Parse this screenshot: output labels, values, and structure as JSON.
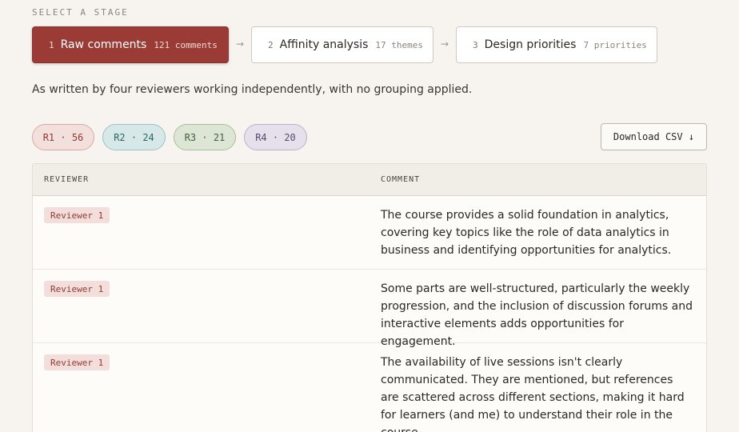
{
  "section_label": "SELECT A STAGE",
  "stages": [
    {
      "num": "1",
      "name": "Raw comments",
      "count": "121 comments",
      "active": true
    },
    {
      "num": "2",
      "name": "Affinity analysis",
      "count": "17 themes",
      "active": false
    },
    {
      "num": "3",
      "name": "Design priorities",
      "count": "7 priorities",
      "active": false
    }
  ],
  "stage_separator": "→",
  "description": "As written by four reviewers working independently, with no grouping applied.",
  "reviewer_filters": [
    {
      "label": "R1 · 56",
      "color": "#8f3a34"
    },
    {
      "label": "R2 · 24",
      "color": "#2e6666"
    },
    {
      "label": "R3 · 21",
      "color": "#485e37"
    },
    {
      "label": "R4 · 20",
      "color": "#574a6b"
    }
  ],
  "download_label": "Download CSV ↓",
  "table": {
    "headers": {
      "reviewer": "REVIEWER",
      "comment": "COMMENT"
    },
    "rows": [
      {
        "reviewer": "Reviewer 1",
        "comment": "The course provides a solid foundation in analytics, covering key topics like the role of data analytics in business and identifying opportunities for analytics."
      },
      {
        "reviewer": "Reviewer 1",
        "comment": "Some parts are well-structured, particularly the weekly progression, and the inclusion of discussion forums and interactive elements adds opportunities for engagement."
      },
      {
        "reviewer": "Reviewer 1",
        "comment": "The availability of live sessions isn't clearly communicated. They are mentioned, but references are scattered across different sections, making it hard for learners (and me) to understand their role in the course."
      }
    ]
  },
  "colors": {
    "accent": "#9b3b36",
    "background": "#f7f4ef"
  }
}
